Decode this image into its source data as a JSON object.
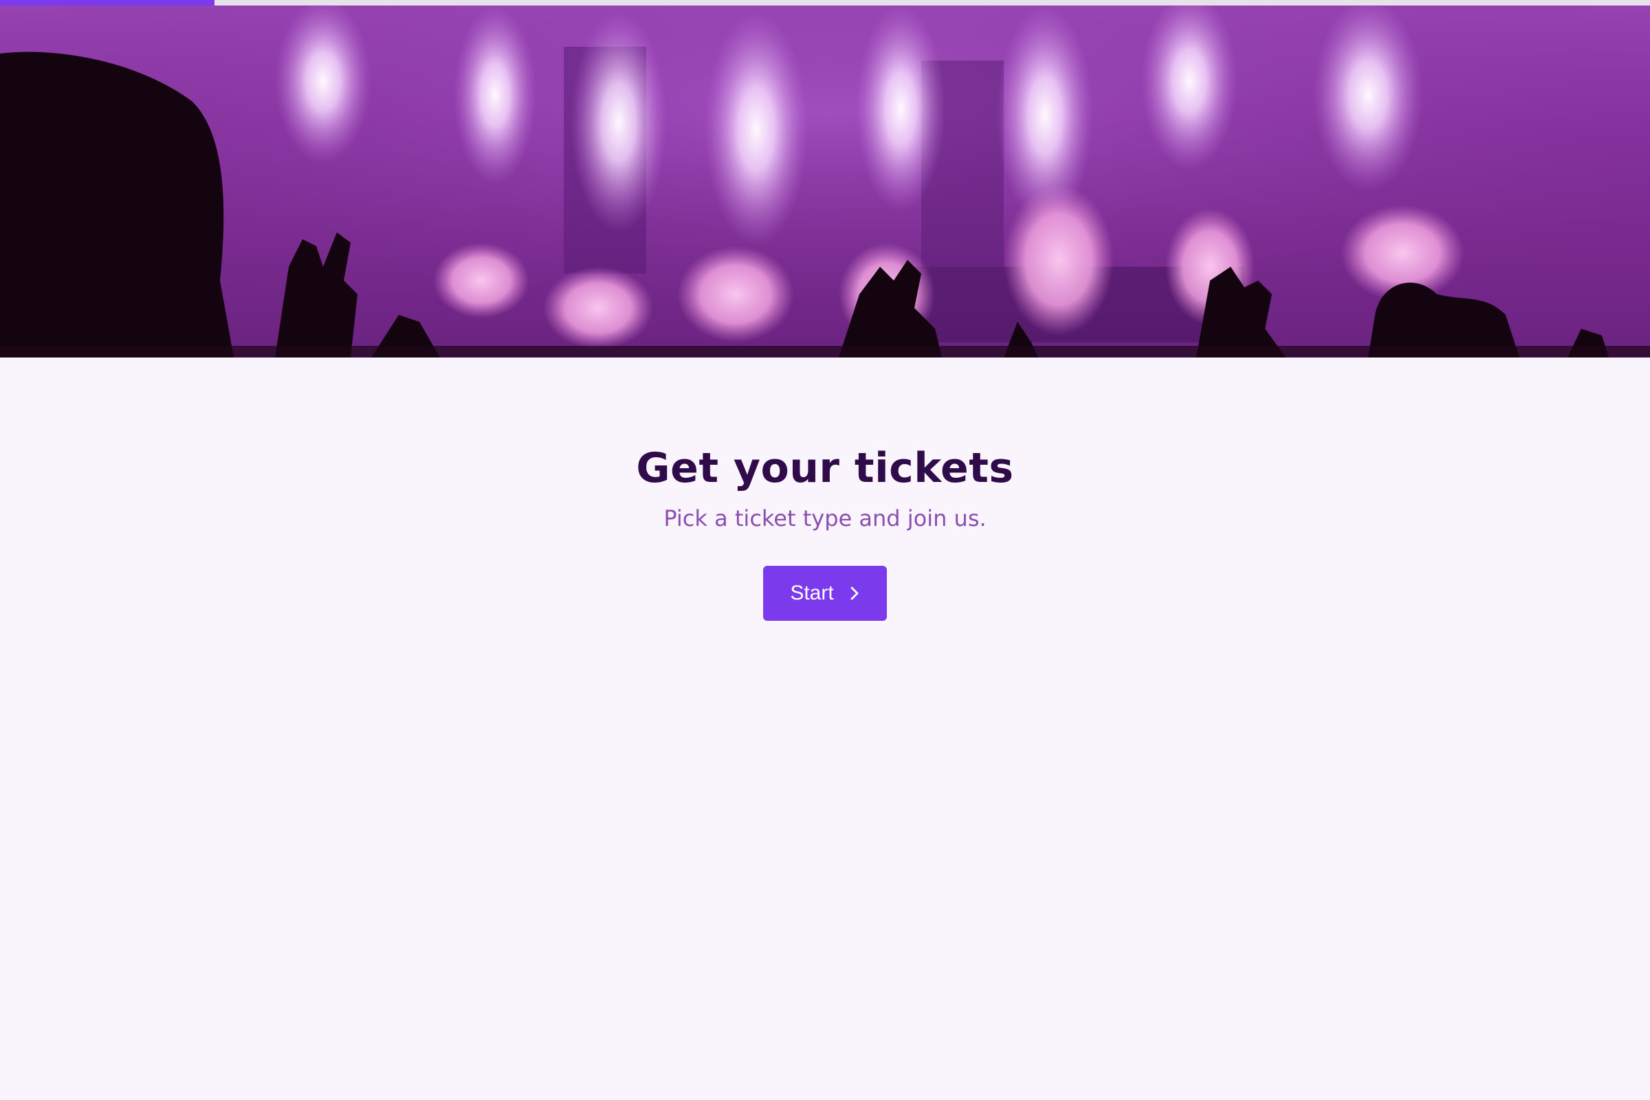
{
  "progress": {
    "fraction": 0.13
  },
  "hero": {
    "image": "concert-crowd-fireworks-photo"
  },
  "main": {
    "title": "Get your tickets",
    "subtitle": "Pick a ticket type and join us.",
    "start_label": "Start",
    "start_icon": "chevron-right-icon"
  },
  "colors": {
    "accent": "#7c3aed",
    "title": "#2f0b4a",
    "subtitle": "#8a4fae",
    "background": "#faf5fc"
  }
}
